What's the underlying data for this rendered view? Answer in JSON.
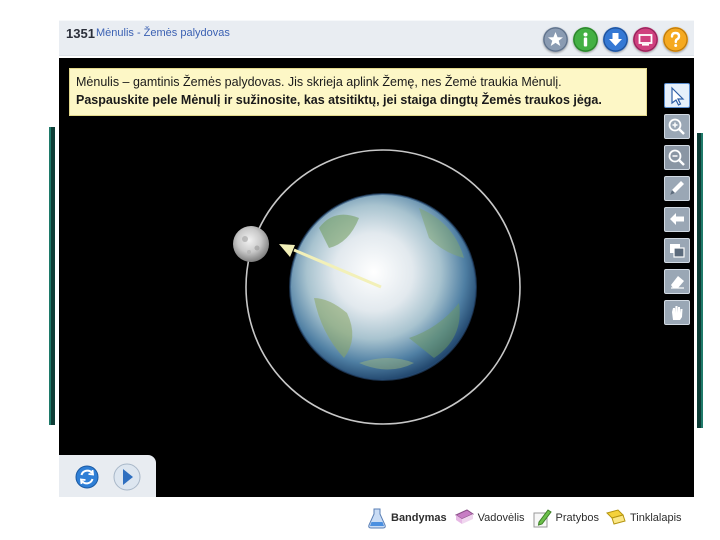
{
  "header": {
    "number": "1351",
    "title": "Mėnulis - Žemės palydovas",
    "icons": [
      "star-icon",
      "info-icon",
      "download-icon",
      "screen-icon",
      "help-icon"
    ]
  },
  "instructions": {
    "line1": "Mėnulis – gamtinis Žemės palydovas. Jis skrieja aplink Žemę, nes Žemė traukia Mėnulį.",
    "line2": "Paspauskite pele Mėnulį ir sužinosite, kas atsitiktų, jei staiga dingtų Žemės traukos jėga."
  },
  "tools": [
    "pointer-icon",
    "zoom-in-icon",
    "zoom-out-icon",
    "pen-icon",
    "undo-icon",
    "screen-capture-icon",
    "eraser-icon",
    "hand-icon"
  ],
  "controls": [
    "reload-icon",
    "next-icon"
  ],
  "bottom_nav": {
    "items": [
      {
        "label": "Bandymas",
        "icon": "flask-icon"
      },
      {
        "label": "Vadovėlis",
        "icon": "book-icon"
      },
      {
        "label": "Pratybos",
        "icon": "pencil-icon"
      },
      {
        "label": "Tinklalapis",
        "icon": "web-icon"
      }
    ]
  },
  "colors": {
    "title_blue": "#3b61b3",
    "note_bg": "#fdf7c6",
    "stage_bg": "#000000",
    "orbit": "#c8c8c8",
    "arrow": "#f2f0b8"
  }
}
